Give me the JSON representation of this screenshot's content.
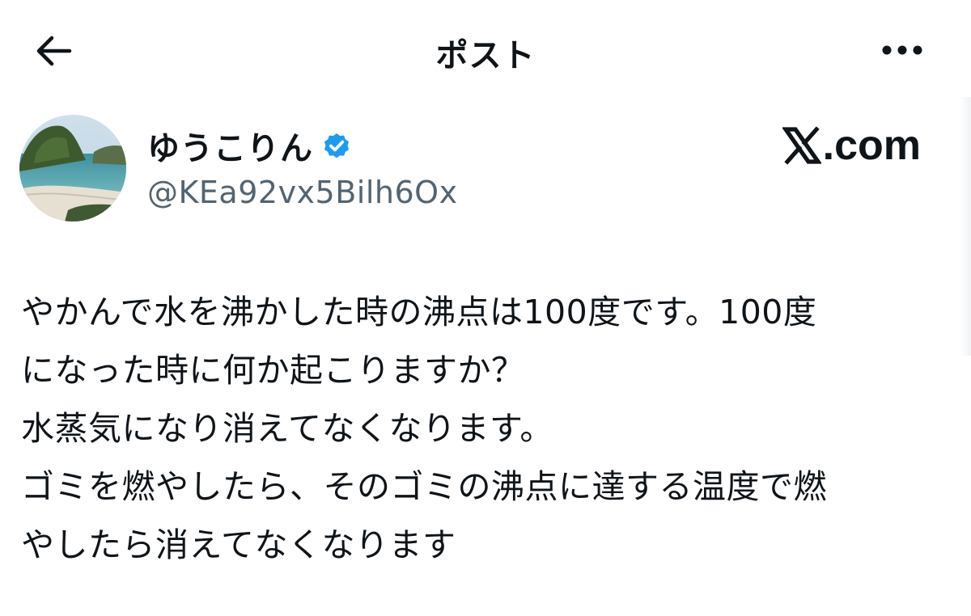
{
  "header": {
    "title": "ポスト",
    "back_icon": "arrow-left-icon",
    "more_icon": "more-horizontal-icon"
  },
  "author": {
    "display_name": "ゆうこりん",
    "handle": "@KEa92vx5Bilh6Ox",
    "verified": true,
    "verified_color": "#1d9bf0",
    "avatar_icon": "beach-cove-avatar"
  },
  "brand": {
    "logo_text": ".com",
    "logo_icon": "x-logo-icon"
  },
  "post": {
    "lines": [
      "やかんで水を沸かした時の沸点は100度です。100度",
      "になった時に何か起こりますか？",
      "水蒸気になり消えてなくなります。",
      "ゴミを燃やしたら、そのゴミの沸点に達する温度で燃",
      "やしたら消えてなくなります"
    ]
  },
  "colors": {
    "text": "#0f1419",
    "secondary": "#536471",
    "accent": "#1d9bf0"
  }
}
